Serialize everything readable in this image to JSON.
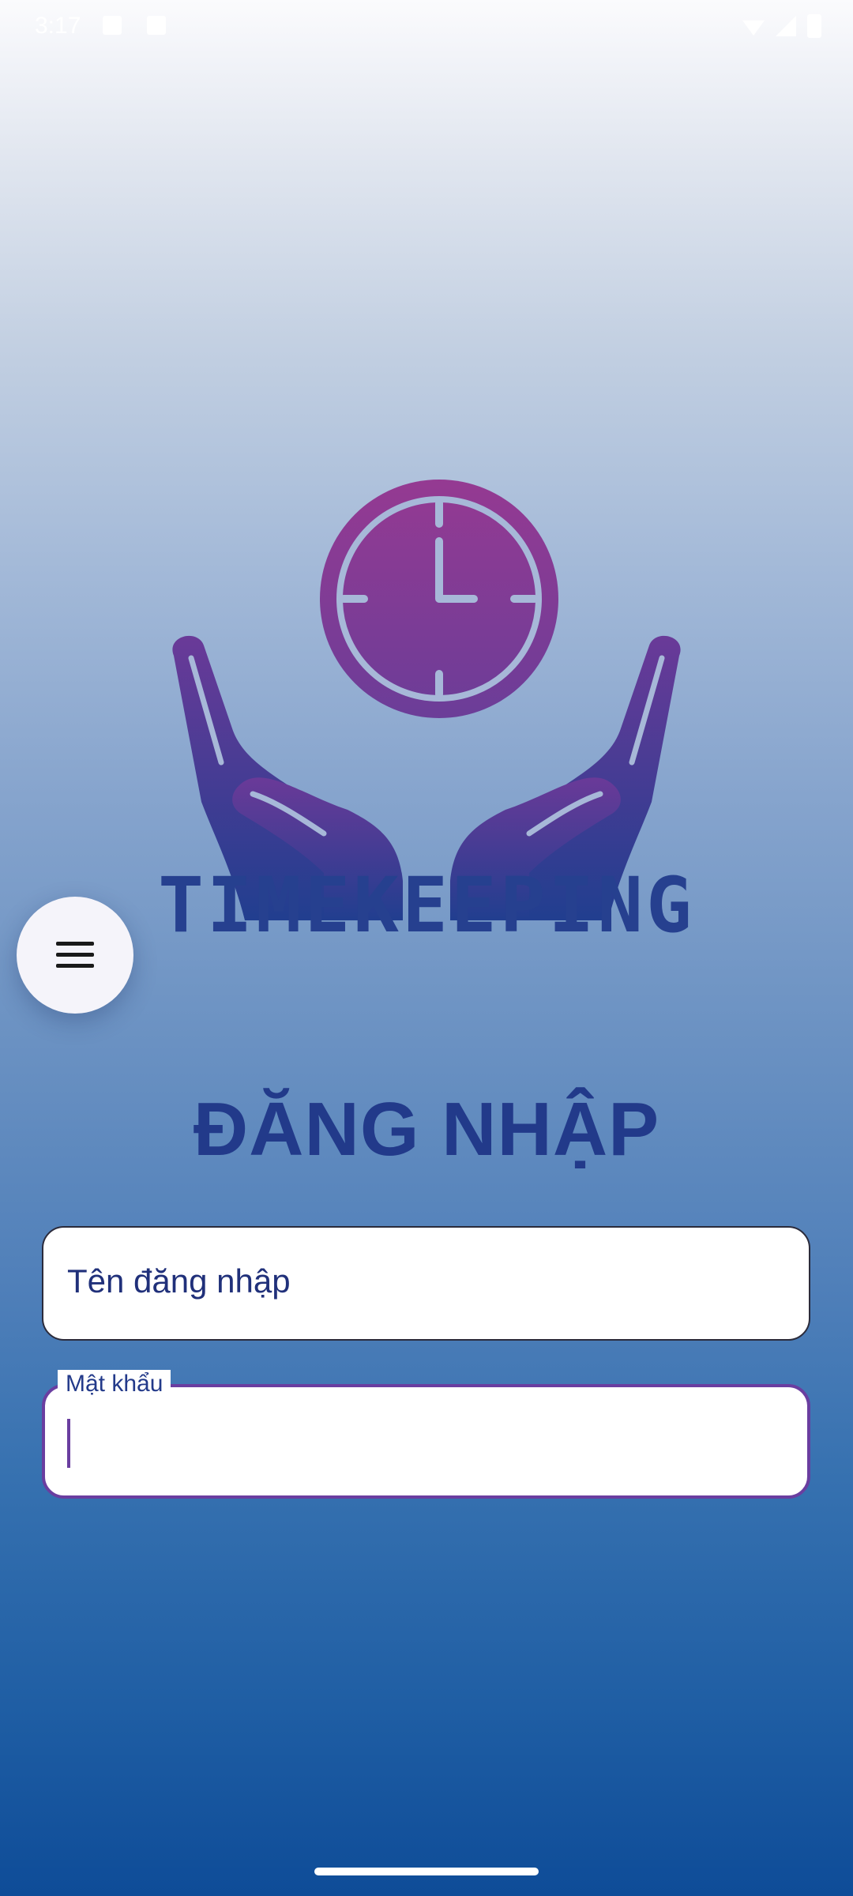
{
  "status_bar": {
    "time": "3:17"
  },
  "app": {
    "logo_text": "TIMEKEEPING",
    "title": "ĐĂNG NHẬP",
    "menu_icon": "hamburger-menu-icon"
  },
  "form": {
    "username": {
      "placeholder": "Tên đăng nhập",
      "value": ""
    },
    "password": {
      "label": "Mật khẩu",
      "value": ""
    }
  },
  "colors": {
    "accent": "#6a3ea0",
    "title": "#223a8a",
    "logo_clock": "#8b3a95",
    "logo_hands": "#2a3f93"
  }
}
